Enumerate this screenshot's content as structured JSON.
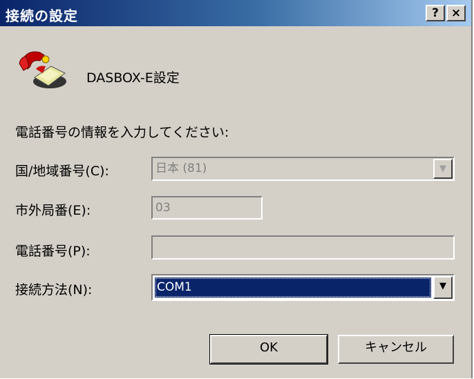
{
  "window": {
    "title": "接続の設定",
    "help_label": "?",
    "close_label": "×"
  },
  "header": {
    "label": "DASBOX-E設定",
    "icon": "telephone-icon"
  },
  "instruction": "電話番号の情報を入力してください:",
  "fields": {
    "country": {
      "label": "国/地域番号(C):",
      "value": "日本 (81)",
      "disabled": true
    },
    "area_code": {
      "label": "市外局番(E):",
      "value": "03",
      "disabled": true
    },
    "phone": {
      "label": "電話番号(P):",
      "value": ""
    },
    "connect_using": {
      "label": "接続方法(N):",
      "value": "COM1"
    }
  },
  "buttons": {
    "ok": "OK",
    "cancel": "キャンセル"
  }
}
